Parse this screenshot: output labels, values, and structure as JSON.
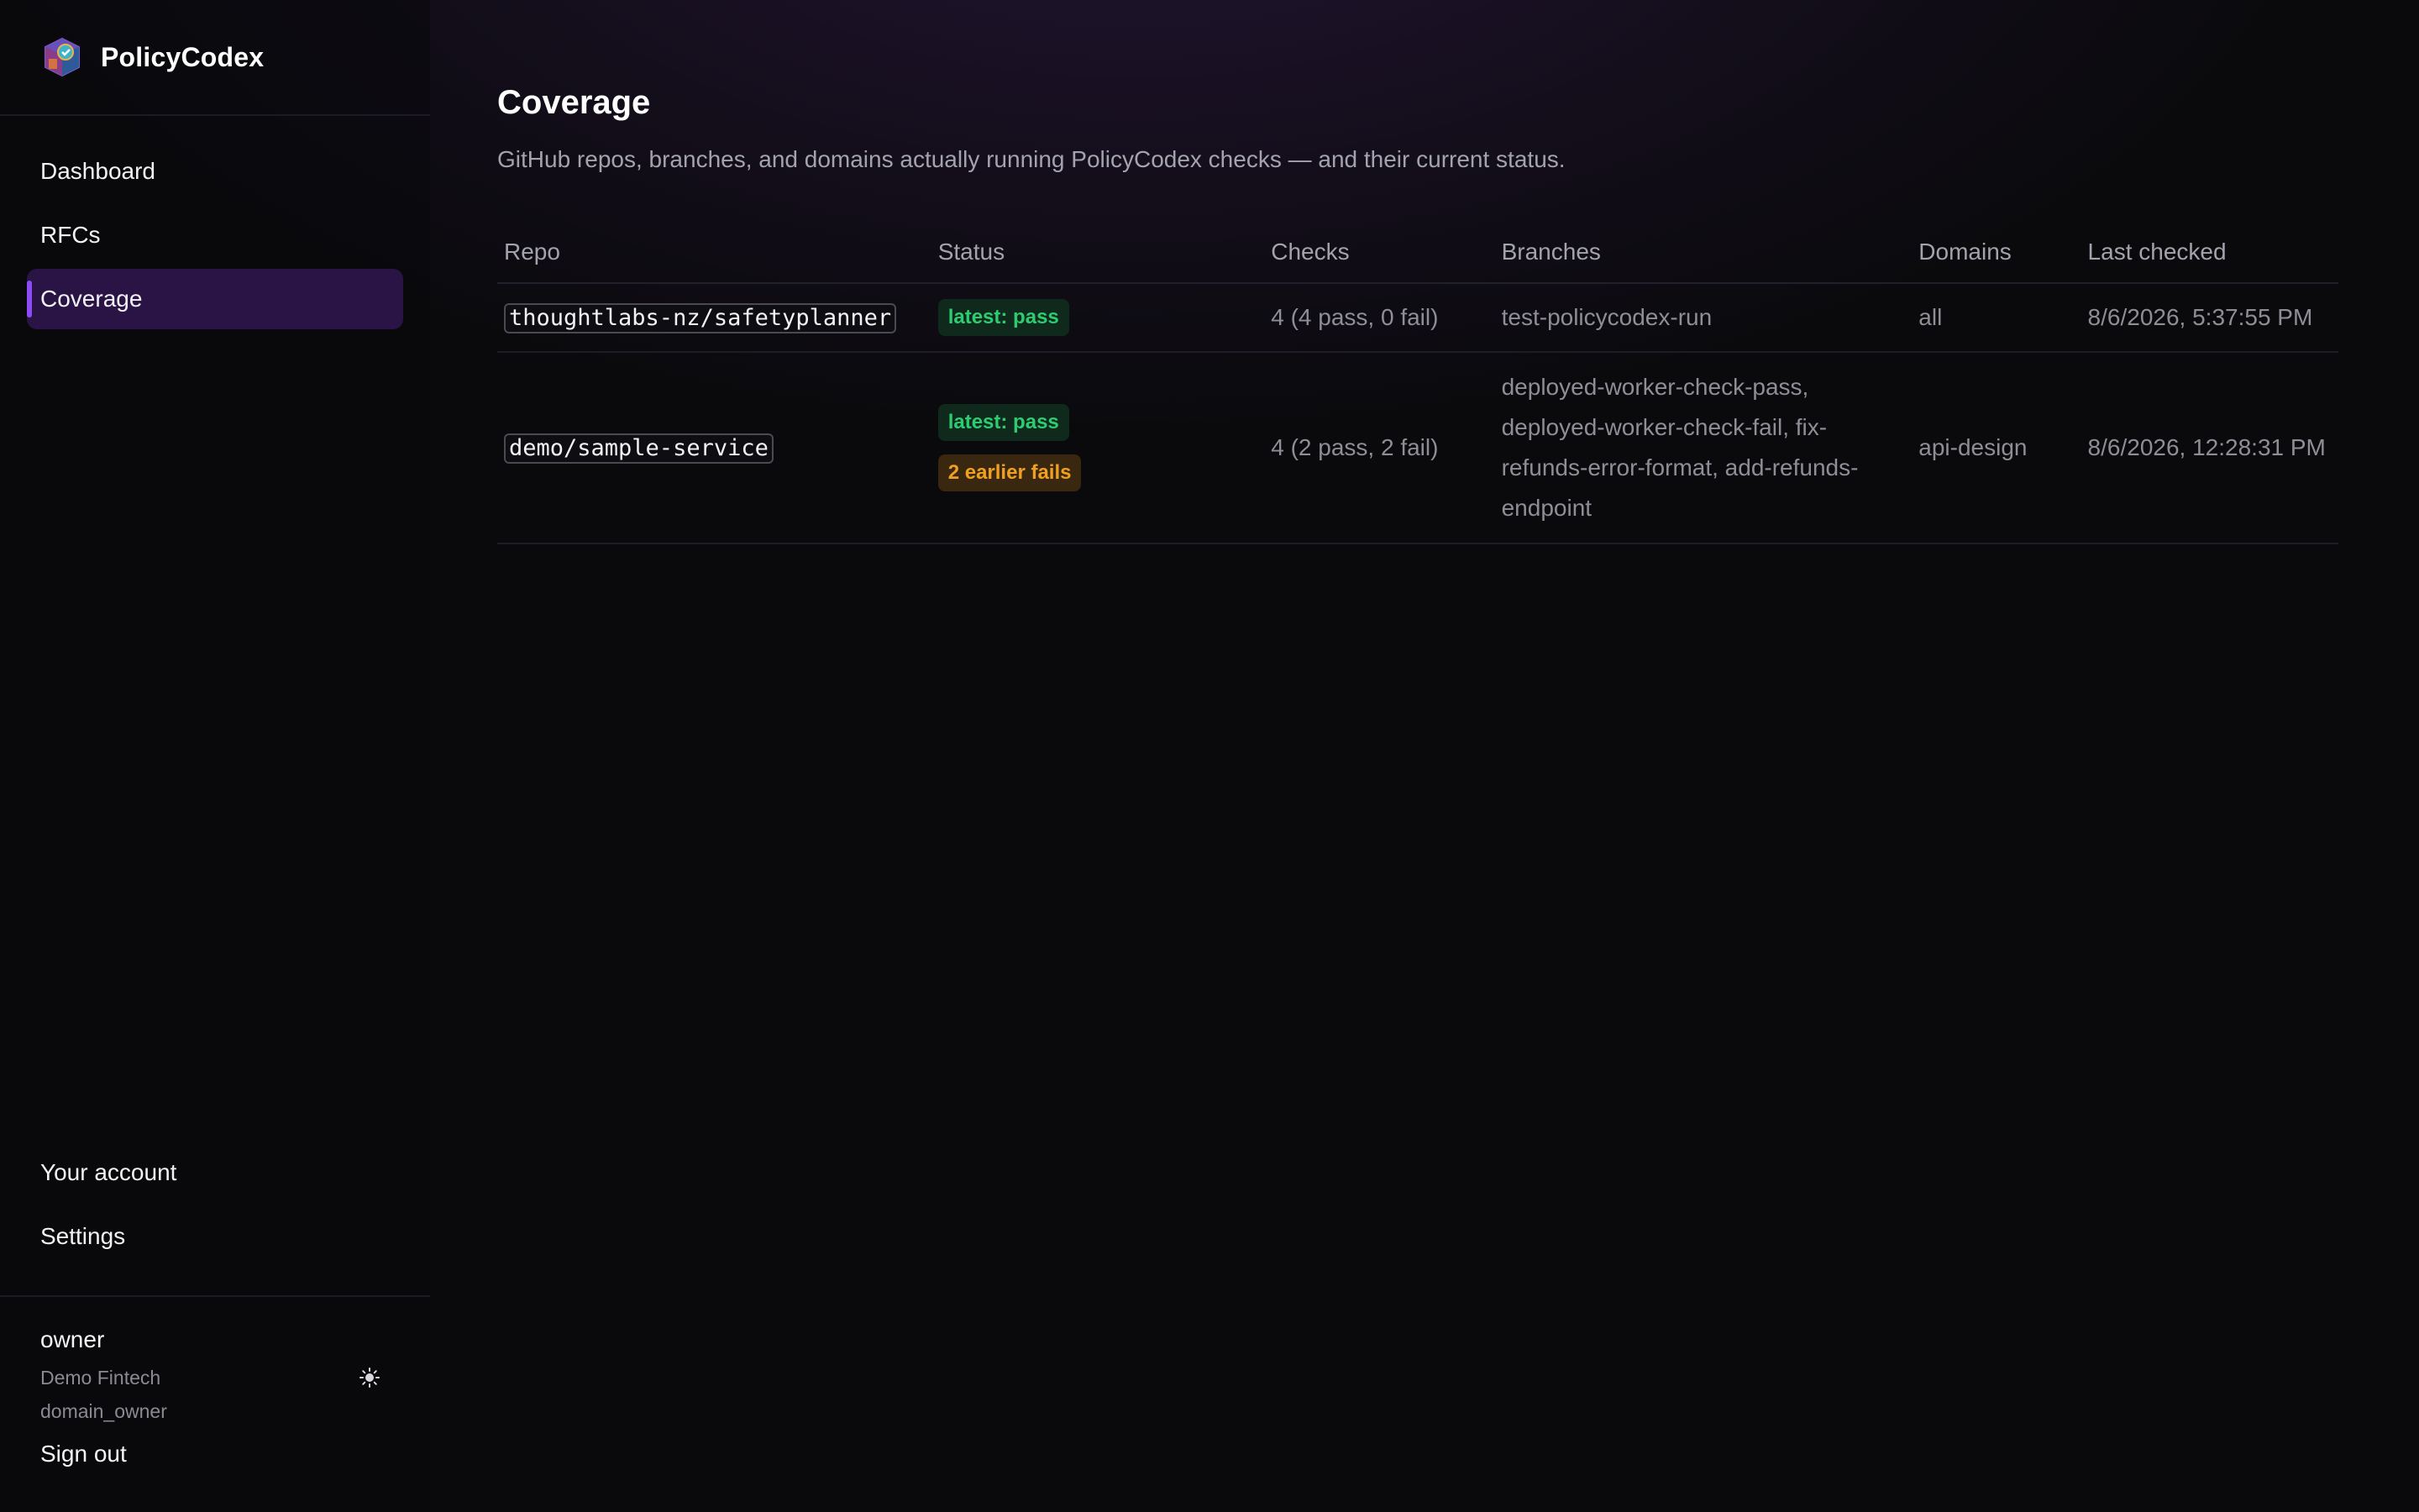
{
  "app": {
    "name": "PolicyCodex"
  },
  "sidebar": {
    "nav": [
      {
        "label": "Dashboard",
        "active": false
      },
      {
        "label": "RFCs",
        "active": false
      },
      {
        "label": "Coverage",
        "active": true
      }
    ],
    "bottom_nav": [
      {
        "label": "Your account"
      },
      {
        "label": "Settings"
      }
    ],
    "user": {
      "name": "owner",
      "org": "Demo Fintech",
      "role": "domain_owner"
    },
    "theme_toggle_icon": "sun-icon",
    "sign_out_label": "Sign out"
  },
  "page": {
    "title": "Coverage",
    "subtitle": "GitHub repos, branches, and domains actually running PolicyCodex checks — and their current status."
  },
  "table": {
    "columns": [
      "Repo",
      "Status",
      "Checks",
      "Branches",
      "Domains",
      "Last checked"
    ],
    "rows": [
      {
        "repo": "thoughtlabs-nz/safetyplanner",
        "status_badges": [
          {
            "label": "latest: pass",
            "kind": "pass"
          }
        ],
        "checks": "4 (4 pass, 0 fail)",
        "branches": "test-policycodex-run",
        "domains": "all",
        "last_checked": "8/6/2026, 5:37:55 PM"
      },
      {
        "repo": "demo/sample-service",
        "status_badges": [
          {
            "label": "latest: pass",
            "kind": "pass"
          },
          {
            "label": "2 earlier fails",
            "kind": "warn"
          }
        ],
        "checks": "4 (2 pass, 2 fail)",
        "branches": "deployed-worker-check-pass, deployed-worker-check-fail, fix-refunds-error-format, add-refunds-endpoint",
        "domains": "api-design",
        "last_checked": "8/6/2026, 12:28:31 PM"
      }
    ]
  },
  "colors": {
    "accent": "#8b4cf5",
    "active_nav_bg": "#2a1446",
    "pass": "#2ecc71",
    "warn": "#f0a020"
  }
}
